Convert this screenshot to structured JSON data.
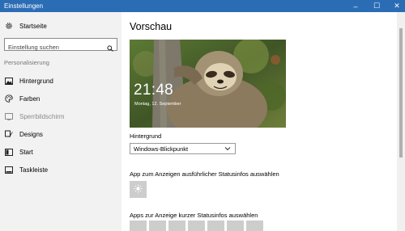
{
  "window": {
    "title": "Einstellungen",
    "minimize": "–",
    "maximize": "☐",
    "close": "✕"
  },
  "sidebar": {
    "home_label": "Startseite",
    "search_placeholder": "Einstellung suchen",
    "section_label": "Personalisierung",
    "items": [
      {
        "label": "Hintergrund",
        "icon": "picture-icon",
        "active": false
      },
      {
        "label": "Farben",
        "icon": "palette-icon",
        "active": false
      },
      {
        "label": "Sperrbildschirm",
        "icon": "lock-screen-icon",
        "active": true
      },
      {
        "label": "Designs",
        "icon": "brush-icon",
        "active": false
      },
      {
        "label": "Start",
        "icon": "start-icon",
        "active": false
      },
      {
        "label": "Taskleiste",
        "icon": "taskbar-icon",
        "active": false
      }
    ]
  },
  "main": {
    "title": "Vorschau",
    "preview": {
      "time": "21:48",
      "date": "Montag, 12. September"
    },
    "background_label": "Hintergrund",
    "background_value": "Windows-Blickpunkt",
    "detailed_status_label": "App zum Anzeigen ausführlicher Statusinfos auswählen",
    "quick_status_label": "Apps zur Anzeige kurzer Statusinfos auswählen"
  },
  "colors": {
    "titlebar": "#2b6db5",
    "sidebar": "#f2f2f2",
    "tile": "#cdcdcd"
  }
}
